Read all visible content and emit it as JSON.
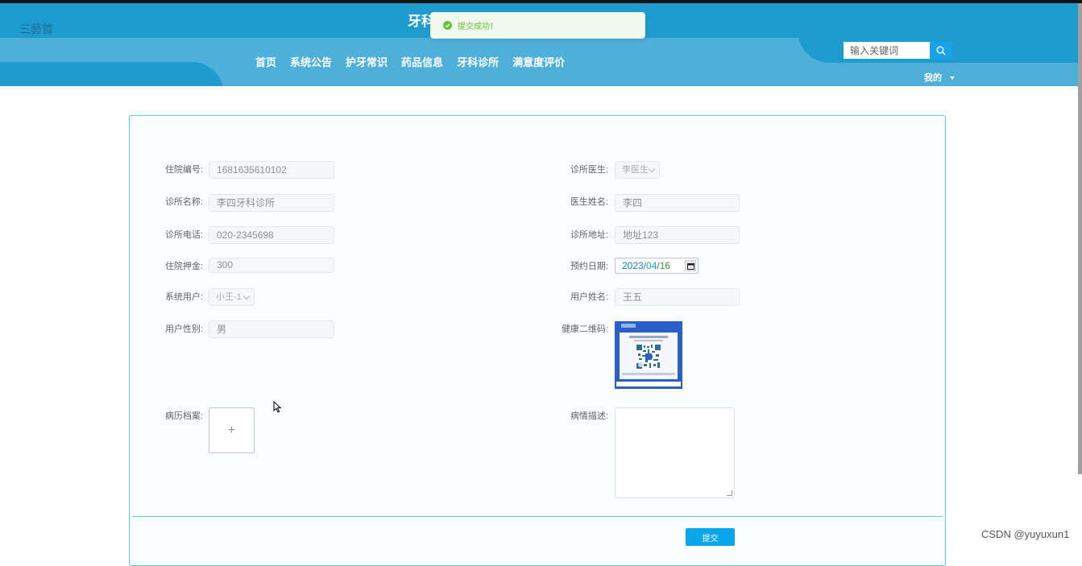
{
  "header": {
    "top_left_link": "三藝首",
    "site_title": "牙科",
    "nav": [
      "首页",
      "系统公告",
      "护牙常识",
      "药品信息",
      "牙科诊所",
      "满意度评价"
    ],
    "search_placeholder": "输入关键词",
    "user_menu": "我的"
  },
  "toast": {
    "message": "提交成功！",
    "type": "success"
  },
  "form": {
    "left": {
      "admission_no": {
        "label": "住院编号:",
        "value": "1681635610102"
      },
      "clinic_name": {
        "label": "诊所名称:",
        "value": "李四牙科诊所"
      },
      "clinic_phone": {
        "label": "诊所电话:",
        "value": "020-2345698"
      },
      "deposit": {
        "label": "住院押金:",
        "value": "300"
      },
      "system_user": {
        "label": "系统用户:",
        "value": "小王-1"
      },
      "user_gender": {
        "label": "用户性别:",
        "value": "男"
      },
      "medical_records": {
        "label": "病历档案:",
        "upload_symbol": "+"
      }
    },
    "right": {
      "clinic_doctor": {
        "label": "诊所医生:",
        "value": "李医生"
      },
      "doctor_name": {
        "label": "医生姓名:",
        "value": "李四"
      },
      "clinic_address": {
        "label": "诊所地址:",
        "value": "地址123"
      },
      "appointment_date": {
        "label": "预约日期:",
        "year": "2023",
        "month": "04",
        "day": "16",
        "sep": "/"
      },
      "user_name": {
        "label": "用户姓名:",
        "value": "王五"
      },
      "health_qr": {
        "label": "健康二维码:"
      },
      "condition_desc": {
        "label": "病情描述:",
        "value": ""
      }
    },
    "submit_label": "提交"
  },
  "watermark": "CSDN @yuyuxun1",
  "colors": {
    "header_dark": "#1f9ccf",
    "header_light": "#4eafd9",
    "card_border": "#5ccbe0",
    "submit": "#0aa6e9",
    "success": "#67c23a"
  }
}
